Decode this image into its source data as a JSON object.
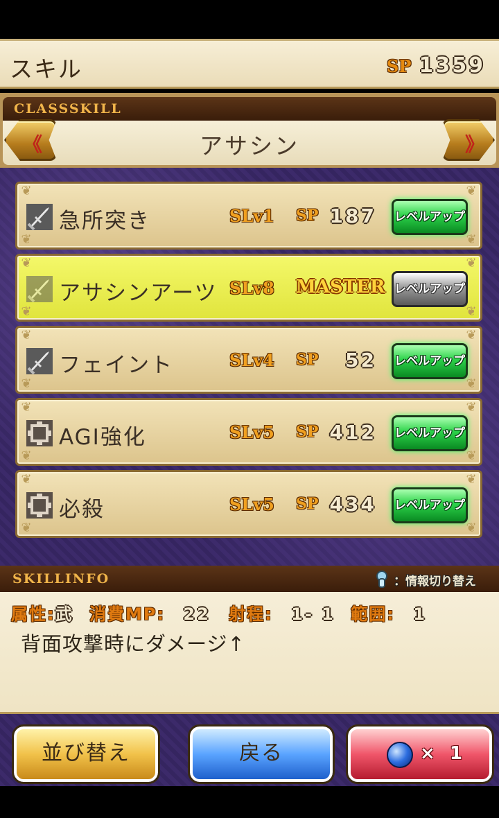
{
  "header": {
    "title": "スキル",
    "sp_label": "SP",
    "sp_value": "1359"
  },
  "class_skill": {
    "section_label": "CLASSSKILL",
    "class_name": "アサシン",
    "prev_glyph": "《",
    "next_glyph": "》"
  },
  "skills": [
    {
      "name": "急所突き",
      "level": "SLv1",
      "sp_label": "SP",
      "sp_cost": "187",
      "button_label": "レベルアップ",
      "icon": "sword-skill-icon",
      "mastered": false
    },
    {
      "name": "アサシンアーツ",
      "level": "SLv8",
      "status": "MASTER",
      "button_label": "レベルアップ",
      "icon": "sword-skill-icon",
      "mastered": true
    },
    {
      "name": "フェイント",
      "level": "SLv4",
      "sp_label": "SP",
      "sp_cost": "52",
      "button_label": "レベルアップ",
      "icon": "sword-skill-icon",
      "mastered": false
    },
    {
      "name": "AGI強化",
      "level": "SLv5",
      "sp_label": "SP",
      "sp_cost": "412",
      "button_label": "レベルアップ",
      "icon": "passive-skill-icon",
      "mastered": false
    },
    {
      "name": "必殺",
      "level": "SLv5",
      "sp_label": "SP",
      "sp_cost": "434",
      "button_label": "レベルアップ",
      "icon": "passive-skill-icon",
      "mastered": false
    }
  ],
  "skill_info": {
    "section_label": "SKILLINFO",
    "toggle_label": "：情報切り替え",
    "attr_label": "属性:",
    "attr_value": "武",
    "mp_label": "消費MP:",
    "mp_value": "22",
    "range_label": "射程:",
    "range_value": "1- 1",
    "area_label": "範囲:",
    "area_value": "1",
    "description": "背面攻撃時にダメージ↑"
  },
  "footer": {
    "sort_label": "並び替え",
    "back_label": "戻る",
    "gem_multiplier": "× 1"
  },
  "colors": {
    "accent_orange": "#f0a020",
    "levelup_green": "#2cd24a",
    "panel_purple": "#3c2a6a",
    "highlight_yellow": "#f4f86a"
  }
}
